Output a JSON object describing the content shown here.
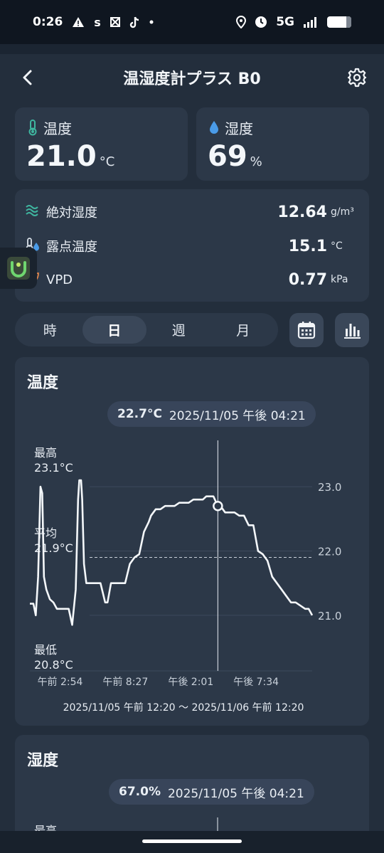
{
  "status_bar": {
    "time": "0:26",
    "network": "5G"
  },
  "header": {
    "title": "温湿度計プラス B0"
  },
  "metrics": {
    "temperature": {
      "label": "温度",
      "value": "21.0",
      "unit": "°C"
    },
    "humidity": {
      "label": "湿度",
      "value": "69",
      "unit": "%"
    }
  },
  "details": [
    {
      "label": "絶対湿度",
      "value": "12.64",
      "unit": "g/m³",
      "icon": "absolute-humidity-icon"
    },
    {
      "label": "露点温度",
      "value": "15.1",
      "unit": "°C",
      "icon": "dew-point-icon"
    },
    {
      "label": "VPD",
      "value": "0.77",
      "unit": "kPa",
      "icon": "vpd-leaf-icon"
    }
  ],
  "tabs": [
    {
      "label": "時"
    },
    {
      "label": "日",
      "active": true
    },
    {
      "label": "週"
    },
    {
      "label": "月"
    }
  ],
  "temp_chart": {
    "title": "温度",
    "tooltip_value": "22.7°C",
    "tooltip_time": "2025/11/05 午後 04:21",
    "max_label": "最高",
    "max_value": "23.1°C",
    "avg_label": "平均",
    "avg_value": "21.9°C",
    "min_label": "最低",
    "min_value": "20.8°C",
    "range_label": "2025/11/05 午前 12:20 〜 2025/11/06 午前 12:20"
  },
  "chart_data": {
    "type": "line",
    "title": "温度",
    "ylim": [
      20.7,
      23.3
    ],
    "y_ticks": [
      23.0,
      22.0,
      21.0
    ],
    "x_tick_labels": [
      "午前 2:54",
      "午前 8:27",
      "午後 2:01",
      "午後 7:34"
    ],
    "x_tick_hours": [
      2.57,
      8.12,
      13.68,
      19.23
    ],
    "average": 21.9,
    "selected": {
      "hour": 15.98,
      "value": 22.7
    },
    "grid": true,
    "series": [
      {
        "x": [
          0.0,
          0.3,
          0.5,
          0.7,
          0.9,
          1.05,
          1.2,
          1.4,
          1.7,
          2.0,
          2.3,
          2.6,
          3.0,
          3.3,
          3.6,
          3.9,
          4.1,
          4.2,
          4.35,
          4.45,
          4.6,
          4.8,
          4.95,
          5.1,
          5.3,
          5.6,
          6.0,
          6.4,
          6.6,
          6.9,
          7.3,
          7.7,
          8.1,
          8.5,
          8.9,
          9.3,
          9.7,
          10.1,
          10.3,
          10.7,
          11.1,
          11.5,
          11.9,
          12.3,
          12.7,
          13.1,
          13.5,
          13.9,
          14.3,
          14.7,
          15.0,
          15.3,
          15.6,
          15.98,
          16.2,
          16.6,
          17.0,
          17.4,
          17.8,
          18.2,
          18.6,
          19.0,
          19.4,
          19.8,
          20.2,
          20.6,
          21.0,
          21.4,
          21.8,
          22.2,
          22.6,
          23.0,
          23.4,
          23.7,
          24.0
        ],
        "y": [
          21.18,
          21.18,
          21.0,
          21.6,
          23.0,
          22.9,
          21.6,
          21.4,
          21.25,
          21.2,
          21.1,
          21.1,
          21.1,
          21.1,
          20.85,
          21.4,
          22.8,
          23.1,
          23.1,
          22.8,
          21.8,
          21.5,
          21.5,
          21.5,
          21.5,
          21.5,
          21.5,
          21.2,
          21.2,
          21.5,
          21.5,
          21.5,
          21.5,
          21.8,
          21.9,
          21.95,
          22.3,
          22.45,
          22.55,
          22.65,
          22.65,
          22.7,
          22.7,
          22.7,
          22.75,
          22.75,
          22.75,
          22.8,
          22.8,
          22.8,
          22.85,
          22.85,
          22.85,
          22.7,
          22.7,
          22.6,
          22.6,
          22.6,
          22.55,
          22.55,
          22.4,
          22.4,
          22.0,
          21.95,
          21.85,
          21.6,
          21.5,
          21.4,
          21.3,
          21.2,
          21.2,
          21.15,
          21.1,
          21.1,
          21.0
        ]
      }
    ]
  },
  "hum_chart": {
    "title": "湿度",
    "tooltip_value": "67.0%",
    "tooltip_time": "2025/11/05 午後 04:21",
    "max_label": "最高"
  },
  "colors": {
    "accent_teal": "#3fb6a0",
    "accent_blue": "#4a9be8",
    "background": "#1b2532",
    "card": "#2c3848"
  }
}
